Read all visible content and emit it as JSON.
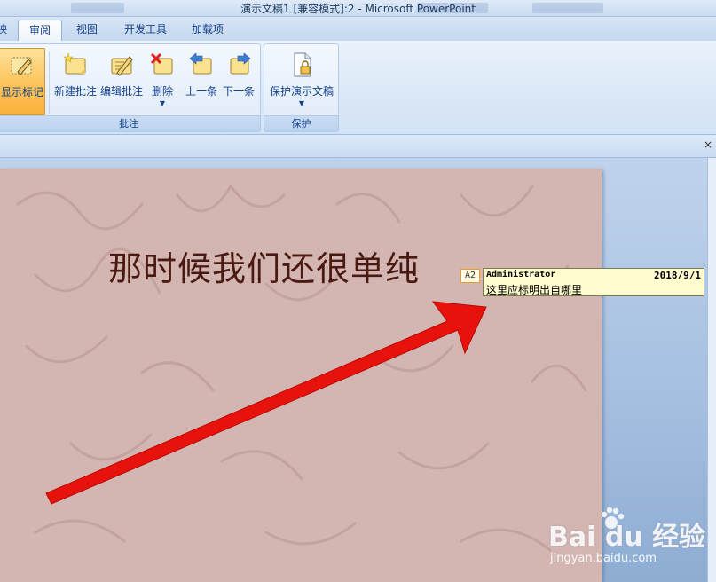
{
  "window": {
    "title": "演示文稿1 [兼容模式]:2 - Microsoft PowerPoint"
  },
  "tabs": [
    {
      "label": "映"
    },
    {
      "label": "审阅",
      "active": true
    },
    {
      "label": "视图"
    },
    {
      "label": "开发工具"
    },
    {
      "label": "加载项"
    }
  ],
  "ribbon": {
    "comments_group": {
      "label": "批注",
      "show_markup": "显示标记",
      "new_comment": "新建批注",
      "edit_comment": "编辑批注",
      "delete": "删除",
      "previous": "上一条",
      "next": "下一条"
    },
    "protect_group": {
      "label": "保护",
      "protect_presentation": "保护演示文稿"
    }
  },
  "strip": {
    "close": "×"
  },
  "slide": {
    "title": "那时候我们还很单纯"
  },
  "comment": {
    "marker": "A2",
    "author": "Administrator",
    "date": "2018/9/1",
    "text": "这里应标明出自哪里"
  },
  "watermark": {
    "brand": "Bai du 经验",
    "url": "jingyan.baidu.com"
  },
  "colors": {
    "accent": "#15428b",
    "slide_bg": "#d3b5b2",
    "arrow": "#e8120c",
    "active_button": "#fbc35a"
  }
}
